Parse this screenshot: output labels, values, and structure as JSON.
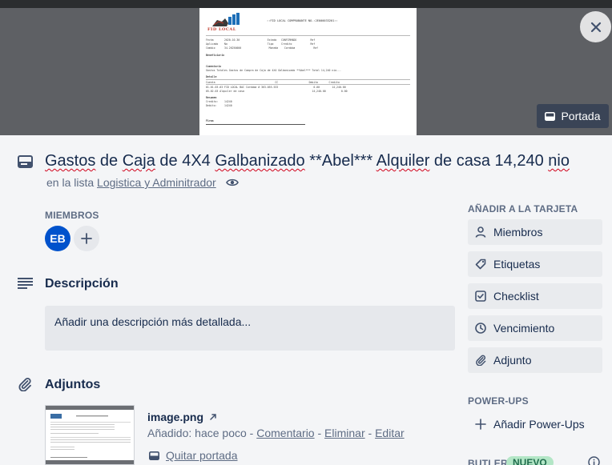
{
  "cover": {
    "button_label": "Portada",
    "doc": {
      "brand": "FID LOCAL",
      "title": "::FID LOCAL COMPROBANTE NO.:2E000033201::"
    }
  },
  "card": {
    "title_parts": [
      "Gastos",
      " de ",
      "Caja",
      " de 4X4 ",
      "Galbanizado",
      " **Abel*** ",
      "Alquiler",
      " de casa 14,240 ",
      "nio"
    ],
    "in_list_prefix": "en la lista",
    "list_name": "Logistica y Adminitrador"
  },
  "members": {
    "label": "MIEMBROS",
    "initials": "EB"
  },
  "description": {
    "heading": "Descripción",
    "placeholder": "Añadir una descripción más detallada..."
  },
  "attachments": {
    "heading": "Adjuntos",
    "items": [
      {
        "name": "image.png",
        "added": "Añadido: hace poco",
        "sep": " - ",
        "comment_label": "Comentario",
        "delete_label": "Eliminar",
        "edit_label": "Editar",
        "remove_cover_label": "Quitar portada"
      }
    ]
  },
  "sidebar": {
    "add_to_card_label": "AÑADIR A LA TARJETA",
    "buttons": [
      {
        "label": "Miembros",
        "icon": "person-icon"
      },
      {
        "label": "Etiquetas",
        "icon": "tag-icon"
      },
      {
        "label": "Checklist",
        "icon": "checkbox-icon"
      },
      {
        "label": "Vencimiento",
        "icon": "clock-icon"
      },
      {
        "label": "Adjunto",
        "icon": "paperclip-icon"
      }
    ],
    "powerups_label": "POWER-UPS",
    "add_powerups_label": "Añadir Power-Ups",
    "butler_label": "BUTLER",
    "new_badge": "NUEVO"
  },
  "colors": {
    "background": "#f4f5f7",
    "avatar": "#0052cc",
    "badge_bg": "#b3e6c6",
    "text_primary": "#172b4d",
    "text_secondary": "#5e6c84"
  }
}
